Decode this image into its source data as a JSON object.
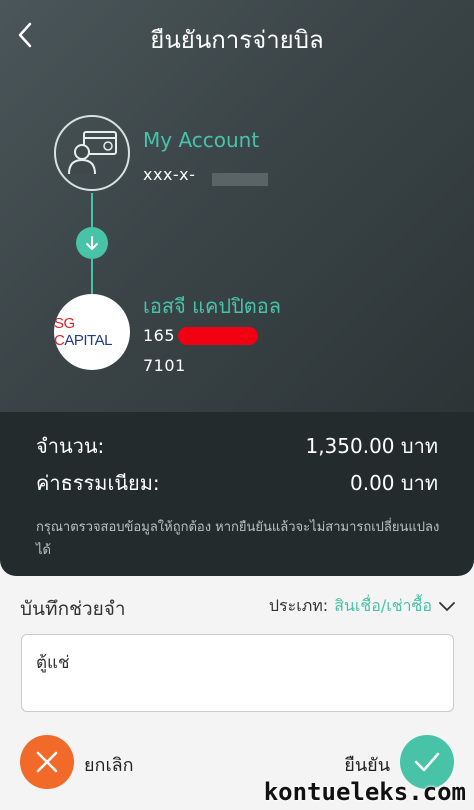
{
  "header": {
    "title": "ยืนยันการจ่ายบิล"
  },
  "from": {
    "name": "My Account",
    "account": "xxx-x-"
  },
  "to": {
    "name": "เอสจี แคปปิตอล",
    "logo_text_red": "SG C",
    "logo_text_blue": "APITAL",
    "ref1": "165",
    "ref2": "7101"
  },
  "summary": {
    "amount_label": "จำนวน:",
    "amount_value": "1,350.00 บาท",
    "fee_label": "ค่าธรรมเนียม:",
    "fee_value": "0.00 บาท",
    "note": "กรุณาตรวจสอบข้อมูลให้ถูกต้อง หากยืนยันแล้วจะไม่สามารถเปลี่ยนแปลงได้"
  },
  "memo": {
    "title": "บันทึกช่วยจำ",
    "type_label": "ประเภท:",
    "type_value": "สินเชื่อ/เช่าซื้อ",
    "text": "ตู้แช่"
  },
  "actions": {
    "cancel_label": "ยกเลิก",
    "confirm_label": "ยืนยัน"
  },
  "watermark": "kontueleks.com",
  "colors": {
    "accent": "#48c3a8",
    "cancel": "#f26a2a",
    "dark_panel": "#232b2d"
  },
  "icons": [
    "back-chevron-icon",
    "account-card-icon",
    "arrow-down-icon",
    "chevron-down-icon",
    "close-icon",
    "check-icon"
  ]
}
